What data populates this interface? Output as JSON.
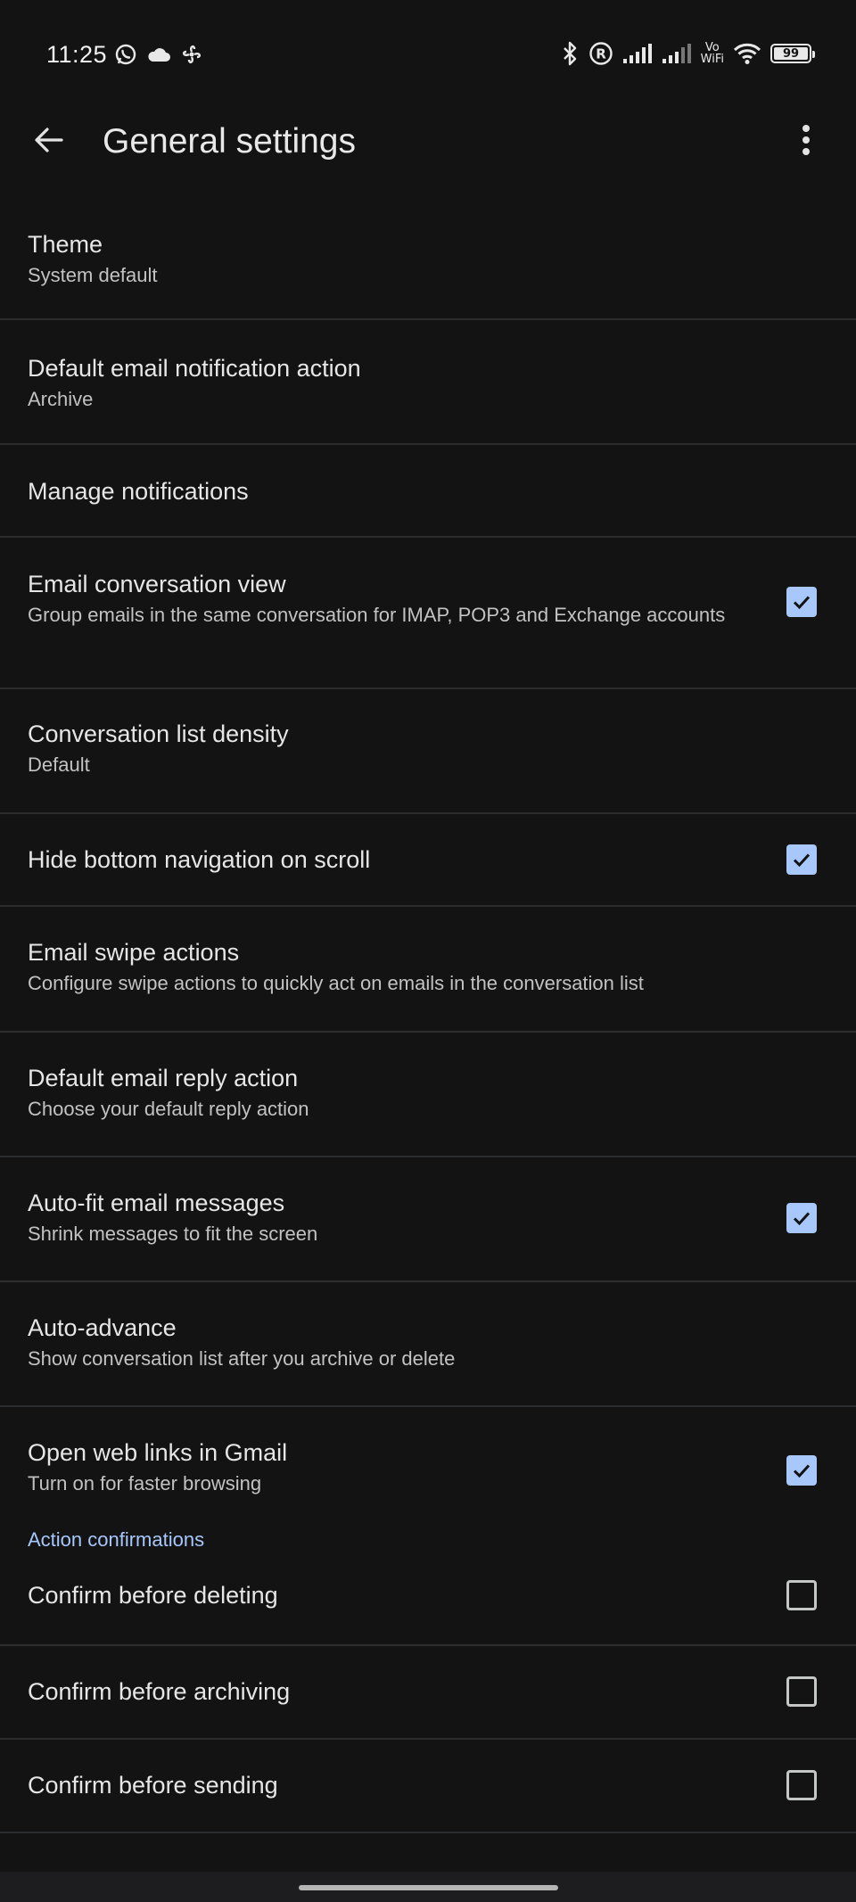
{
  "status_bar": {
    "time": "11:25",
    "left_icons": [
      "whatsapp-icon",
      "cloud-icon",
      "fan-icon"
    ],
    "right_icons": [
      "bluetooth-icon",
      "registered-icon",
      "signal-icon",
      "signal-weak-icon",
      "vowifi-icon",
      "wifi-icon",
      "battery-icon"
    ],
    "vowifi_top": "Vo",
    "vowifi_bottom": "WiFi",
    "battery": "99"
  },
  "app_bar": {
    "back_icon": "arrow-left-icon",
    "title": "General settings",
    "more_icon": "more-vert-icon"
  },
  "settings": [
    {
      "id": "theme",
      "title": "Theme",
      "subtitle": "System default",
      "checkbox": null
    },
    {
      "id": "notification-action",
      "title": "Default email notification action",
      "subtitle": "Archive",
      "checkbox": null
    },
    {
      "id": "manage-notifications",
      "title": "Manage notifications",
      "subtitle": "",
      "checkbox": null
    },
    {
      "id": "conversation-view",
      "title": "Email conversation view",
      "subtitle": "Group emails in the same conversation for IMAP, POP3 and Exchange accounts",
      "checkbox": true
    },
    {
      "id": "list-density",
      "title": "Conversation list density",
      "subtitle": "Default",
      "checkbox": null
    },
    {
      "id": "hide-bottom-nav",
      "title": "Hide bottom navigation on scroll",
      "subtitle": "",
      "checkbox": true
    },
    {
      "id": "swipe-actions",
      "title": "Email swipe actions",
      "subtitle": "Configure swipe actions to quickly act on emails in the conversation list",
      "checkbox": null
    },
    {
      "id": "reply-action",
      "title": "Default email reply action",
      "subtitle": "Choose your default reply action",
      "checkbox": null
    },
    {
      "id": "auto-fit",
      "title": "Auto-fit email messages",
      "subtitle": "Shrink messages to fit the screen",
      "checkbox": true
    },
    {
      "id": "auto-advance",
      "title": "Auto-advance",
      "subtitle": "Show conversation list after you archive or delete",
      "checkbox": null
    },
    {
      "id": "web-links",
      "title": "Open web links in Gmail",
      "subtitle": "Turn on for faster browsing",
      "checkbox": true
    }
  ],
  "action_confirmations": {
    "header": "Action confirmations",
    "items": [
      {
        "id": "confirm-delete",
        "title": "Confirm before deleting",
        "checkbox": false
      },
      {
        "id": "confirm-archive",
        "title": "Confirm before archiving",
        "checkbox": false
      },
      {
        "id": "confirm-send",
        "title": "Confirm before sending",
        "checkbox": false
      }
    ]
  },
  "colors": {
    "background": "#131314",
    "accent": "#a8c7fa",
    "divider": "#2b2c2e"
  }
}
